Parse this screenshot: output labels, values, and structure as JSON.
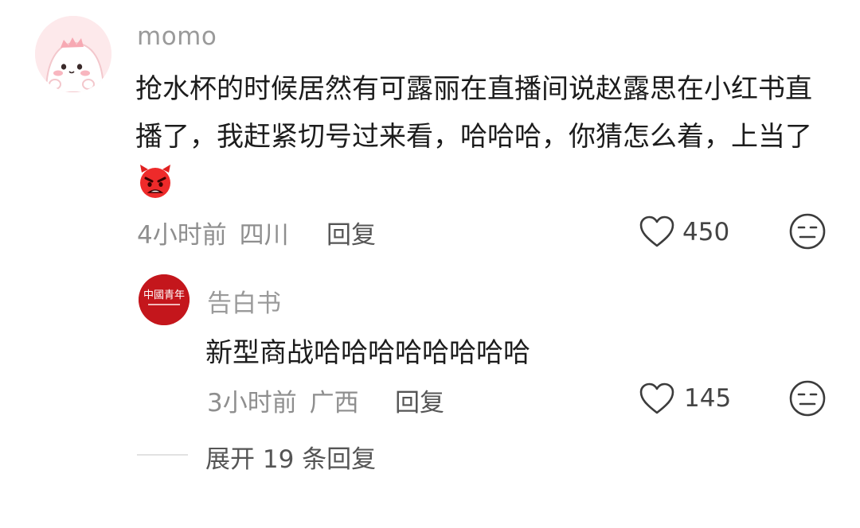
{
  "comment": {
    "username": "momo",
    "text": "抢水杯的时候居然有可露丽在直播间说赵露思在小红书直播了，我赶紧切号过来看，哈哈哈，你猜怎么着，上当了",
    "emoji": "angry-face-emoji",
    "time": "4小时前",
    "location": "四川",
    "reply_label": "回复",
    "likes": "450"
  },
  "reply": {
    "username": "告白书",
    "avatar_text": "中國青年",
    "text": "新型商战哈哈哈哈哈哈哈哈",
    "time": "3小时前",
    "location": "广西",
    "reply_label": "回复",
    "likes": "145"
  },
  "expand_label": "展开 19 条回复",
  "colors": {
    "secondary_text": "#8e8e8e",
    "primary_text": "#1c1c1c",
    "reply_avatar": "#c4161c",
    "main_avatar": "#fce8ea"
  }
}
